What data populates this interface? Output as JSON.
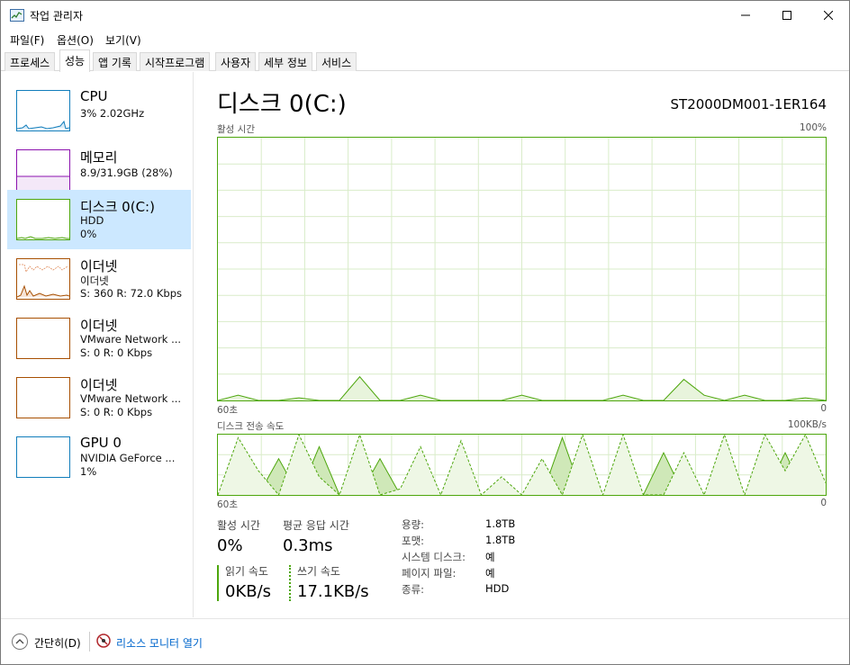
{
  "window": {
    "title": "작업 관리자"
  },
  "menu": [
    "파일(F)",
    "옵션(O)",
    "보기(V)"
  ],
  "tabs": [
    {
      "label": "프로세스",
      "active": false
    },
    {
      "label": "성능",
      "active": true
    },
    {
      "label": "앱 기록",
      "active": false
    },
    {
      "label": "시작프로그램",
      "active": false
    },
    {
      "label": "사용자",
      "active": false
    },
    {
      "label": "세부 정보",
      "active": false
    },
    {
      "label": "서비스",
      "active": false
    }
  ],
  "sidebar": {
    "items": [
      {
        "name": "CPU",
        "line1": "3% 2.02GHz",
        "line2": "",
        "color": "#117dbb"
      },
      {
        "name": "메모리",
        "line1": "8.9/31.9GB (28%)",
        "line2": "",
        "color": "#8b12ae"
      },
      {
        "name": "디스크 0(C:)",
        "line1": "HDD",
        "line2": "0%",
        "color": "#4da60c"
      },
      {
        "name": "이더넷",
        "line1": "이더넷",
        "line2": "S: 360  R: 72.0 Kbps",
        "color": "#a74f01"
      },
      {
        "name": "이더넷",
        "line1": "VMware Network ...",
        "line2": "S: 0  R: 0 Kbps",
        "color": "#a74f01"
      },
      {
        "name": "이더넷",
        "line1": "VMware Network ...",
        "line2": "S: 0  R: 0 Kbps",
        "color": "#a74f01"
      },
      {
        "name": "GPU 0",
        "line1": "NVIDIA GeForce ...",
        "line2": "1%",
        "color": "#117dbb"
      }
    ]
  },
  "main": {
    "title": "디스크 0(C:)",
    "model": "ST2000DM001-1ER164",
    "active_graph": {
      "label": "활성 시간",
      "max_label": "100%",
      "left_label": "60초",
      "right_label": "0"
    },
    "transfer_graph": {
      "label": "디스크 전송 속도",
      "max_label": "100KB/s",
      "left_label": "60초",
      "right_label": "0"
    },
    "stats": {
      "active_time_label": "활성 시간",
      "active_time_value": "0%",
      "avg_response_label": "평균 응답 시간",
      "avg_response_value": "0.3ms",
      "read_label": "읽기 속도",
      "read_value": "0KB/s",
      "write_label": "쓰기 속도",
      "write_value": "17.1KB/s"
    },
    "properties": [
      {
        "key": "용량:",
        "value": "1.8TB"
      },
      {
        "key": "포맷:",
        "value": "1.8TB"
      },
      {
        "key": "시스템 디스크:",
        "value": "예"
      },
      {
        "key": "페이지 파일:",
        "value": "예"
      },
      {
        "key": "종류:",
        "value": "HDD"
      }
    ]
  },
  "footer": {
    "fewer_details": "간단히(D)",
    "resource_monitor": "리소스 모니터 열기"
  },
  "chart_data": [
    {
      "type": "area",
      "title": "활성 시간",
      "xlabel": "",
      "ylabel": "",
      "xlim": [
        60,
        0
      ],
      "ylim": [
        0,
        100
      ],
      "grid": true,
      "x": [
        60,
        58,
        56,
        54,
        52,
        50,
        48,
        46,
        44,
        42,
        40,
        38,
        36,
        34,
        32,
        30,
        28,
        26,
        24,
        22,
        20,
        18,
        16,
        14,
        12,
        10,
        8,
        6,
        4,
        2,
        0
      ],
      "series": [
        {
          "values": [
            0,
            2,
            0,
            0,
            1,
            0,
            0,
            9,
            0,
            0,
            2,
            0,
            0,
            0,
            0,
            2,
            0,
            0,
            0,
            0,
            2,
            0,
            0,
            8,
            2,
            0,
            2,
            0,
            0,
            1,
            0
          ]
        }
      ]
    },
    {
      "type": "line",
      "title": "디스크 전송 속도",
      "xlabel": "",
      "ylabel": "",
      "xlim": [
        60,
        0
      ],
      "ylim": [
        0,
        100
      ],
      "grid": true,
      "x": [
        60,
        58,
        56,
        54,
        52,
        50,
        48,
        46,
        44,
        42,
        40,
        38,
        36,
        34,
        32,
        30,
        28,
        26,
        24,
        22,
        20,
        18,
        16,
        14,
        12,
        10,
        8,
        6,
        4,
        2,
        0
      ],
      "series": [
        {
          "values": [
            0,
            0,
            0,
            60,
            0,
            80,
            0,
            0,
            60,
            0,
            0,
            0,
            0,
            0,
            0,
            0,
            0,
            95,
            0,
            0,
            0,
            0,
            70,
            0,
            0,
            0,
            0,
            0,
            70,
            0,
            0
          ]
        },
        {
          "values": [
            0,
            95,
            40,
            0,
            100,
            30,
            0,
            100,
            0,
            10,
            80,
            0,
            90,
            0,
            30,
            0,
            60,
            0,
            100,
            0,
            100,
            0,
            0,
            70,
            0,
            100,
            0,
            100,
            40,
            100,
            20
          ]
        }
      ]
    }
  ]
}
